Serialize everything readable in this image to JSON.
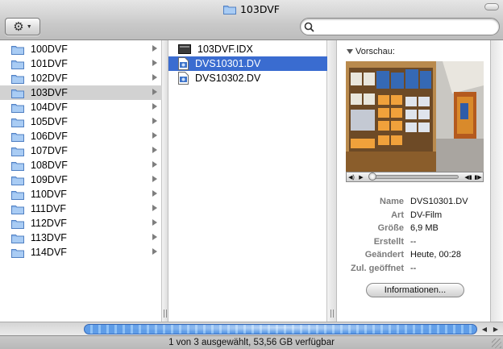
{
  "window": {
    "title": "103DVF"
  },
  "toolbar": {
    "action_icon": "gear-icon",
    "search": {
      "value": "",
      "placeholder": ""
    }
  },
  "columns": {
    "folders": [
      {
        "label": "100DVF",
        "selected": false
      },
      {
        "label": "101DVF",
        "selected": false
      },
      {
        "label": "102DVF",
        "selected": false
      },
      {
        "label": "103DVF",
        "selected": true
      },
      {
        "label": "104DVF",
        "selected": false
      },
      {
        "label": "105DVF",
        "selected": false
      },
      {
        "label": "106DVF",
        "selected": false
      },
      {
        "label": "107DVF",
        "selected": false
      },
      {
        "label": "108DVF",
        "selected": false
      },
      {
        "label": "109DVF",
        "selected": false
      },
      {
        "label": "110DVF",
        "selected": false
      },
      {
        "label": "111DVF",
        "selected": false
      },
      {
        "label": "112DVF",
        "selected": false
      },
      {
        "label": "113DVF",
        "selected": false
      },
      {
        "label": "114DVF",
        "selected": false
      }
    ],
    "files": [
      {
        "label": "103DVF.IDX",
        "icon": "index-file-icon",
        "selected": false
      },
      {
        "label": "DVS10301.DV",
        "icon": "dv-movie-file-icon",
        "selected": true
      },
      {
        "label": "DVS10302.DV",
        "icon": "dv-movie-file-icon",
        "selected": false
      }
    ]
  },
  "preview": {
    "heading": "Vorschau:",
    "info": [
      {
        "key": "Name",
        "value": "DVS10301.DV"
      },
      {
        "key": "Art",
        "value": "DV-Film"
      },
      {
        "key": "Größe",
        "value": "6,9 MB"
      },
      {
        "key": "Erstellt",
        "value": "--"
      },
      {
        "key": "Geändert",
        "value": "Heute, 00:28"
      },
      {
        "key": "Zul. geöffnet",
        "value": "--"
      }
    ],
    "more_info_button": "Informationen..."
  },
  "status_bar": {
    "text": "1 von 3 ausgewählt, 53,56 GB verfügbar"
  },
  "colors": {
    "selection_active": "#3a6cd0",
    "selection_inactive": "#d2d2d2",
    "scroll_thumb": "#5f9de8"
  }
}
